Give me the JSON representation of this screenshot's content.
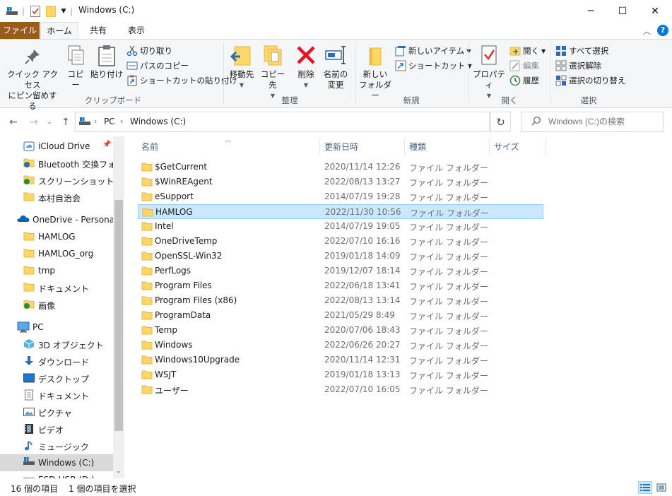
{
  "window": {
    "title": "Windows (C:)",
    "controls": {
      "minimize": "─",
      "maximize": "☐",
      "close": "✕"
    }
  },
  "ribbon_tabs": [
    {
      "label": "ファイル"
    },
    {
      "label": "ホーム"
    },
    {
      "label": "共有"
    },
    {
      "label": "表示"
    }
  ],
  "ribbon": {
    "clipboard": {
      "group_label": "クリップボード",
      "pin_label_1": "クイック アクセス",
      "pin_label_2": "にピン留めする",
      "copy": "コピー",
      "paste": "貼り付け",
      "cut": "切り取り",
      "copy_path": "パスのコピー",
      "paste_shortcut": "ショートカットの貼り付け"
    },
    "organize": {
      "group_label": "整理",
      "move_to": "移動先",
      "copy_to": "コピー先",
      "delete": "削除",
      "rename_1": "名前の",
      "rename_2": "変更"
    },
    "new": {
      "group_label": "新規",
      "new_folder_1": "新しい",
      "new_folder_2": "フォルダー",
      "new_item": "新しいアイテム",
      "easy_access": "ショートカット"
    },
    "open": {
      "group_label": "開く",
      "properties": "プロパティ",
      "open": "開く",
      "edit": "編集",
      "history": "履歴"
    },
    "select": {
      "group_label": "選択",
      "select_all": "すべて選択",
      "select_none": "選択解除",
      "invert": "選択の切り替え"
    }
  },
  "address": {
    "crumbs": [
      "PC",
      "Windows (C:)"
    ],
    "search_placeholder": "Windows (C:)の検索"
  },
  "nav_pane": {
    "items": [
      {
        "label": "iCloud Drive",
        "icon": "icloud-icon"
      },
      {
        "label": "Bluetooth 交換フォル",
        "icon": "bluetooth-folder-icon"
      },
      {
        "label": "スクリーンショット",
        "icon": "screenshot-folder-icon"
      },
      {
        "label": "本村自治会",
        "icon": "folder-icon"
      },
      {
        "label": "OneDrive - Personal",
        "icon": "onedrive-icon"
      },
      {
        "label": "HAMLOG",
        "icon": "folder-icon"
      },
      {
        "label": "HAMLOG_org",
        "icon": "folder-icon"
      },
      {
        "label": "tmp",
        "icon": "folder-icon"
      },
      {
        "label": "ドキュメント",
        "icon": "folder-icon"
      },
      {
        "label": "画像",
        "icon": "pictures-folder-icon"
      },
      {
        "label": "PC",
        "icon": "pc-icon"
      },
      {
        "label": "3D オブジェクト",
        "icon": "3d-objects-icon"
      },
      {
        "label": "ダウンロード",
        "icon": "download-icon"
      },
      {
        "label": "デスクトップ",
        "icon": "desktop-icon"
      },
      {
        "label": "ドキュメント",
        "icon": "documents-icon"
      },
      {
        "label": "ピクチャ",
        "icon": "pictures-icon"
      },
      {
        "label": "ビデオ",
        "icon": "video-icon"
      },
      {
        "label": "ミュージック",
        "icon": "music-icon"
      },
      {
        "label": "Windows (C:)",
        "icon": "drive-icon"
      },
      {
        "label": "ESD-USB (D:)",
        "icon": "usb-drive-icon"
      }
    ]
  },
  "columns": {
    "name": "名前",
    "date": "更新日時",
    "type": "種類",
    "size": "サイズ"
  },
  "files": [
    {
      "name": "$GetCurrent",
      "date": "2020/11/14 12:26",
      "type": "ファイル フォルダー"
    },
    {
      "name": "$WinREAgent",
      "date": "2022/08/13 13:27",
      "type": "ファイル フォルダー"
    },
    {
      "name": "eSupport",
      "date": "2014/07/19 19:28",
      "type": "ファイル フォルダー"
    },
    {
      "name": "HAMLOG",
      "date": "2022/11/30 10:56",
      "type": "ファイル フォルダー"
    },
    {
      "name": "Intel",
      "date": "2014/07/19 19:05",
      "type": "ファイル フォルダー"
    },
    {
      "name": "OneDriveTemp",
      "date": "2022/07/10 16:16",
      "type": "ファイル フォルダー"
    },
    {
      "name": "OpenSSL-Win32",
      "date": "2019/01/18 14:09",
      "type": "ファイル フォルダー"
    },
    {
      "name": "PerfLogs",
      "date": "2019/12/07 18:14",
      "type": "ファイル フォルダー"
    },
    {
      "name": "Program Files",
      "date": "2022/06/18 13:41",
      "type": "ファイル フォルダー"
    },
    {
      "name": "Program Files (x86)",
      "date": "2022/08/13 13:14",
      "type": "ファイル フォルダー"
    },
    {
      "name": "ProgramData",
      "date": "2021/05/29 8:49",
      "type": "ファイル フォルダー"
    },
    {
      "name": "Temp",
      "date": "2020/07/06 18:43",
      "type": "ファイル フォルダー"
    },
    {
      "name": "Windows",
      "date": "2022/06/26 20:27",
      "type": "ファイル フォルダー"
    },
    {
      "name": "Windows10Upgrade",
      "date": "2020/11/14 12:31",
      "type": "ファイル フォルダー"
    },
    {
      "name": "WSJT",
      "date": "2019/01/18 13:13",
      "type": "ファイル フォルダー"
    },
    {
      "name": "ユーザー",
      "date": "2022/07/10 16:05",
      "type": "ファイル フォルダー"
    }
  ],
  "status": {
    "count": "16 個の項目",
    "selected": "1 個の項目を選択"
  },
  "colors": {
    "file_tab": "#9c5a1b",
    "selection": "#cce8ff",
    "folder": "#ffd766",
    "accent": "#0078d7"
  }
}
